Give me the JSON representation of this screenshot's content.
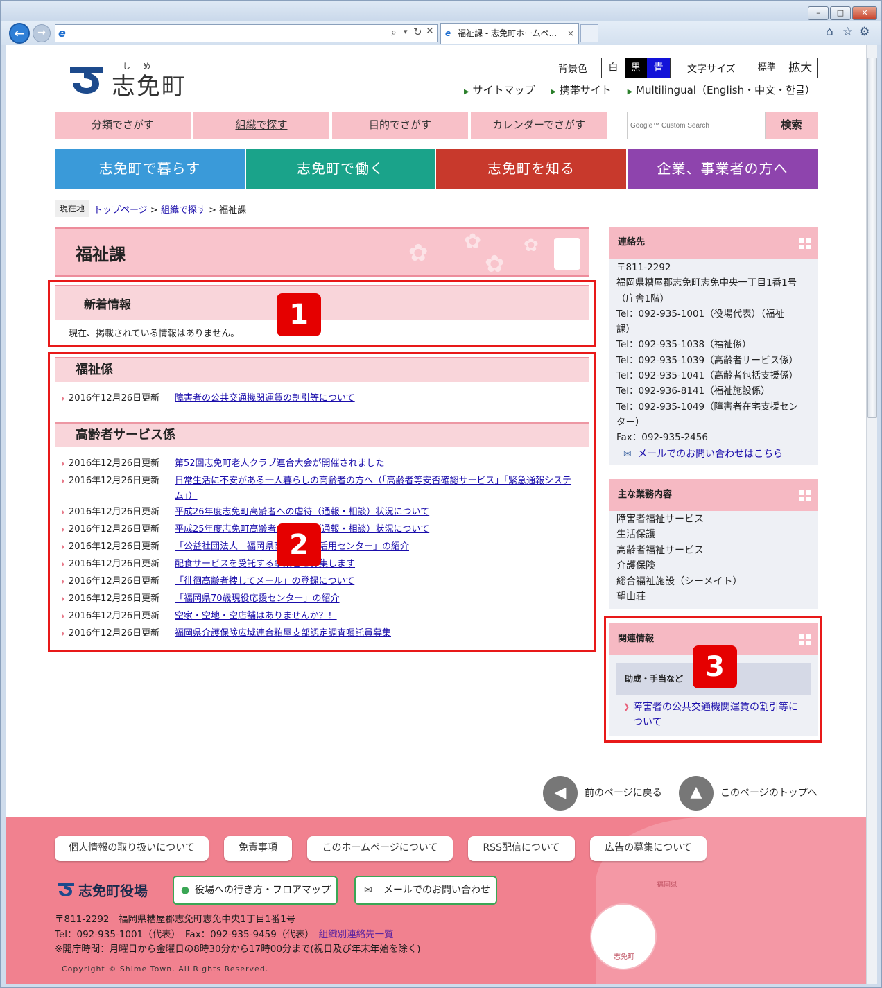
{
  "browser": {
    "tab_title": "福祉課 - 志免町ホームペ...",
    "close_tab": "×",
    "minimize": "–",
    "maximize": "□",
    "close_window": "✕"
  },
  "header": {
    "logo_ruby": "しめ",
    "logo_text": "志免町",
    "bgcolor_label": "背景色",
    "bg_white": "白",
    "bg_black": "黒",
    "bg_blue": "青",
    "fontsize_label": "文字サイズ",
    "font_standard": "標準",
    "font_large": "拡大",
    "links": [
      "サイトマップ",
      "携帯サイト",
      "Multilingual（English・中文・한글）"
    ]
  },
  "nav": {
    "items": [
      "分類でさがす",
      "組織で探す",
      "目的でさがす",
      "カレンダーでさがす"
    ],
    "search_placeholder": "Google™ Custom Search",
    "search_button": "検索"
  },
  "categories": [
    "志免町で暮らす",
    "志免町で働く",
    "志免町を知る",
    "企業、事業者の方へ"
  ],
  "breadcrumb": {
    "label": "現在地",
    "top": "トップページ",
    "org": "組織で探す",
    "current": "福祉課",
    "sep": ">"
  },
  "page_title": "福祉課",
  "news": {
    "heading": "新着情報",
    "empty": "現在、掲載されている情報はありません。"
  },
  "sections": [
    {
      "heading": "福祉係",
      "items": [
        {
          "date": "2016年12月26日更新",
          "title": "障害者の公共交通機関運賃の割引等について"
        }
      ]
    },
    {
      "heading": "高齢者サービス係",
      "items": [
        {
          "date": "2016年12月26日更新",
          "title": "第52回志免町老人クラブ連合大会が開催されました"
        },
        {
          "date": "2016年12月26日更新",
          "title": "日常生活に不安がある一人暮らしの高齢者の方へ（「高齢者等安否確認サービス」「緊急通報システム」）"
        },
        {
          "date": "2016年12月26日更新",
          "title": "平成26年度志免町高齢者への虐待（通報・相談）状況について"
        },
        {
          "date": "2016年12月26日更新",
          "title": "平成25年度志免町高齢者への虐待（通報・相談）状況について"
        },
        {
          "date": "2016年12月26日更新",
          "title": "「公益社団法人　福岡県高齢者能力活用センター」の紹介"
        },
        {
          "date": "2016年12月26日更新",
          "title": "配食サービスを受託する事業者を募集します"
        },
        {
          "date": "2016年12月26日更新",
          "title": "「徘徊高齢者捜してメール」の登録について"
        },
        {
          "date": "2016年12月26日更新",
          "title": "「福岡県70歳現役応援センター」の紹介"
        },
        {
          "date": "2016年12月26日更新",
          "title": "空家・空地・空店舗はありませんか？！"
        },
        {
          "date": "2016年12月26日更新",
          "title": "福岡県介護保険広域連合粕屋支部認定調査嘱託員募集"
        }
      ]
    }
  ],
  "contact": {
    "heading": "連絡先",
    "lines": [
      "〒811-2292",
      "福岡県糟屋郡志免町志免中央一丁目1番1号",
      "（庁舎1階）",
      "Tel：092-935-1001（役場代表）（福祉",
      "課）",
      "Tel：092-935-1038（福祉係）",
      "Tel：092-935-1039（高齢者サービス係）",
      "Tel：092-935-1041（高齢者包括支援係）",
      "Tel：092-936-8141（福祉施設係）",
      "Tel：092-935-1049（障害者在宅支援セン",
      "ター）",
      "Fax：092-935-2456"
    ],
    "mail_link": "メールでのお問い合わせはこちら"
  },
  "duties": {
    "heading": "主な業務内容",
    "items": [
      "障害者福祉サービス",
      "生活保護",
      "高齢者福祉サービス",
      "介護保険",
      "総合福祉施設（シーメイト）",
      "望山荘"
    ]
  },
  "related": {
    "heading": "関連情報",
    "subheading": "助成・手当など",
    "link_line1": "障害者の公共交通機関運賃の割引等に",
    "link_line2": "ついて"
  },
  "badges": [
    "1",
    "2",
    "3"
  ],
  "page_nav": {
    "back": "前のページに戻る",
    "top": "このページのトップへ"
  },
  "footer": {
    "links": [
      "個人情報の取り扱いについて",
      "免責事項",
      "このホームページについて",
      "RSS配信について",
      "広告の募集について"
    ],
    "office": "志免町役場",
    "access_button": "役場への行き方・フロアマップ",
    "mail_button": "メールでのお問い合わせ",
    "address": "〒811-2292　福岡県糟屋郡志免町志免中央1丁目1番1号",
    "tel": "Tel：092-935-1001（代表）　Fax：092-935-9459（代表）",
    "contact_list": "組織別連絡先一覧",
    "hours": "※開庁時間：月曜日から金曜日の8時30分から17時00分まで(祝日及び年末年始を除く)",
    "copyright": "Copyright © Shime Town. All Rights Reserved.",
    "map_pref": "福岡県",
    "map_town": "志免町"
  },
  "colors": {
    "cat1": "#3a9ad9",
    "cat2": "#1aa38a",
    "cat3": "#c8392c",
    "cat4": "#8e44ad",
    "footer": "#f1818f",
    "pink_nav": "#f8c0c8",
    "highlight": "#e81919"
  }
}
